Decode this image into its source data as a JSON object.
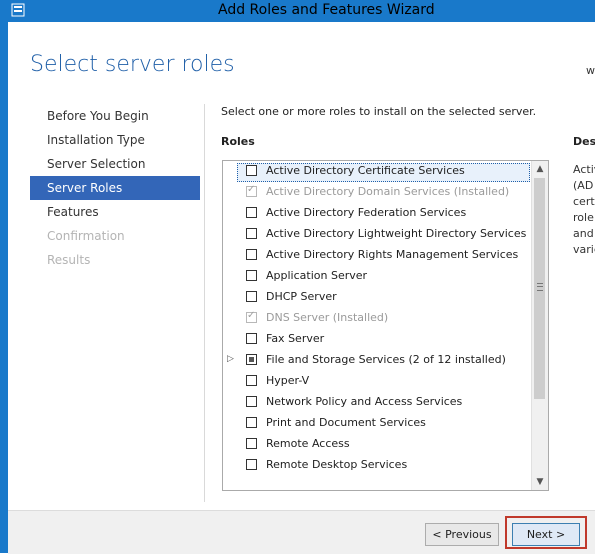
{
  "window": {
    "title": "Add Roles and Features Wizard",
    "icon": "server-manager-icon"
  },
  "page": {
    "title": "Select server roles",
    "destination_fragment": "w"
  },
  "nav": {
    "items": [
      {
        "label": "Before You Begin",
        "state": "normal"
      },
      {
        "label": "Installation Type",
        "state": "normal"
      },
      {
        "label": "Server Selection",
        "state": "normal"
      },
      {
        "label": "Server Roles",
        "state": "active"
      },
      {
        "label": "Features",
        "state": "normal"
      },
      {
        "label": "Confirmation",
        "state": "disabled"
      },
      {
        "label": "Results",
        "state": "disabled"
      }
    ]
  },
  "main": {
    "instruction": "Select one or more roles to install on the selected server.",
    "roles_header": "Roles",
    "description_header": "Desc",
    "description_lines": [
      "Activ",
      "(AD",
      "certi",
      "role",
      "and",
      "varie"
    ]
  },
  "roles": [
    {
      "label": "Active Directory Certificate Services",
      "state": "unchecked",
      "selected": true,
      "installed": false,
      "expandable": false
    },
    {
      "label": "Active Directory Domain Services (Installed)",
      "state": "installed",
      "selected": false,
      "installed": true,
      "expandable": false
    },
    {
      "label": "Active Directory Federation Services",
      "state": "unchecked",
      "selected": false,
      "installed": false,
      "expandable": false
    },
    {
      "label": "Active Directory Lightweight Directory Services",
      "state": "unchecked",
      "selected": false,
      "installed": false,
      "expandable": false
    },
    {
      "label": "Active Directory Rights Management Services",
      "state": "unchecked",
      "selected": false,
      "installed": false,
      "expandable": false
    },
    {
      "label": "Application Server",
      "state": "unchecked",
      "selected": false,
      "installed": false,
      "expandable": false
    },
    {
      "label": "DHCP Server",
      "state": "unchecked",
      "selected": false,
      "installed": false,
      "expandable": false
    },
    {
      "label": "DNS Server (Installed)",
      "state": "installed",
      "selected": false,
      "installed": true,
      "expandable": false
    },
    {
      "label": "Fax Server",
      "state": "unchecked",
      "selected": false,
      "installed": false,
      "expandable": false
    },
    {
      "label": "File and Storage Services (2 of 12 installed)",
      "state": "partial",
      "selected": false,
      "installed": false,
      "expandable": true
    },
    {
      "label": "Hyper-V",
      "state": "unchecked",
      "selected": false,
      "installed": false,
      "expandable": false
    },
    {
      "label": "Network Policy and Access Services",
      "state": "unchecked",
      "selected": false,
      "installed": false,
      "expandable": false
    },
    {
      "label": "Print and Document Services",
      "state": "unchecked",
      "selected": false,
      "installed": false,
      "expandable": false
    },
    {
      "label": "Remote Access",
      "state": "unchecked",
      "selected": false,
      "installed": false,
      "expandable": false
    },
    {
      "label": "Remote Desktop Services",
      "state": "unchecked",
      "selected": false,
      "installed": false,
      "expandable": false
    }
  ],
  "footer": {
    "previous_label": "< Previous",
    "next_label": "Next >"
  },
  "colors": {
    "accent": "#1979ca",
    "nav_active": "#3366b8",
    "title_blue": "#1f5fa8",
    "highlight_outline": "#c0392b"
  }
}
